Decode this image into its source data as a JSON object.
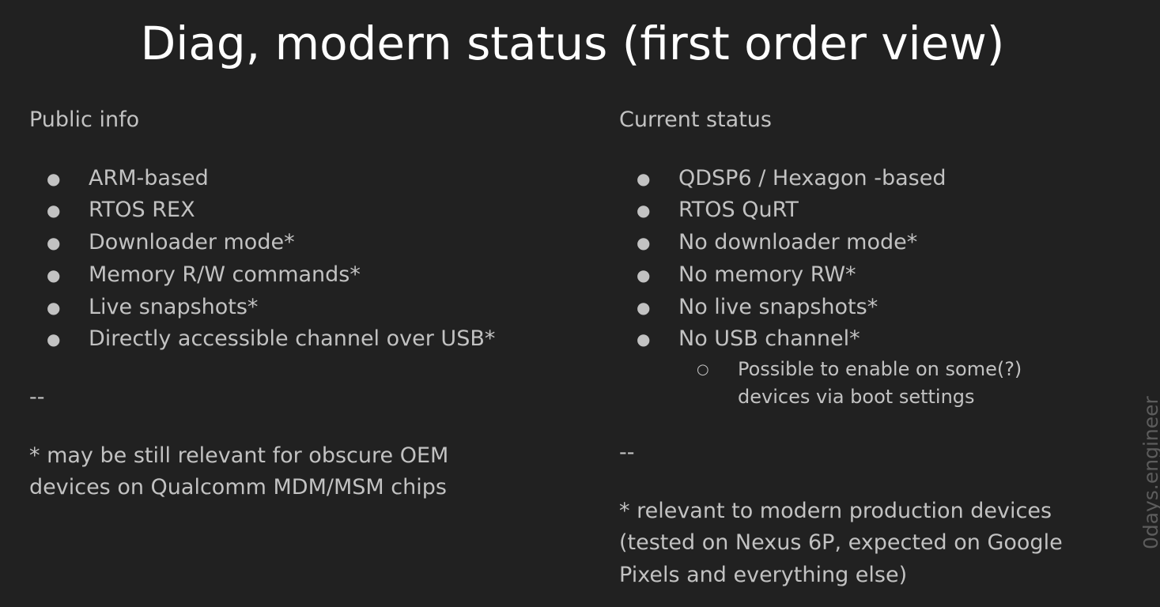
{
  "title": "Diag, modern status (first order view)",
  "left": {
    "heading": "Public info",
    "bullets": [
      "ARM-based",
      "RTOS REX",
      "Downloader mode*",
      "Memory R/W commands*",
      "Live snapshots*",
      "Directly accessible channel over USB*"
    ],
    "separator": "--",
    "footnote": "* may be still relevant for obscure OEM devices on Qualcomm MDM/MSM chips"
  },
  "right": {
    "heading": "Current status",
    "bullets": [
      "QDSP6 / Hexagon -based",
      "RTOS QuRT",
      "No downloader mode*",
      "No memory RW*",
      "No live snapshots*",
      "No USB channel*"
    ],
    "sub_bullets": [
      "Possible to enable on some(?) devices via boot settings"
    ],
    "separator": "--",
    "footnote": "* relevant to modern production devices (tested on Nexus 6P, expected on Google Pixels and everything else)"
  },
  "bullet_glyph": "●",
  "sub_bullet_glyph": "○",
  "watermark": "0days.engineer",
  "colors": {
    "background": "#212121",
    "title": "#ffffff",
    "body_text": "#c2c2c2",
    "watermark": "#5c5c5c"
  }
}
